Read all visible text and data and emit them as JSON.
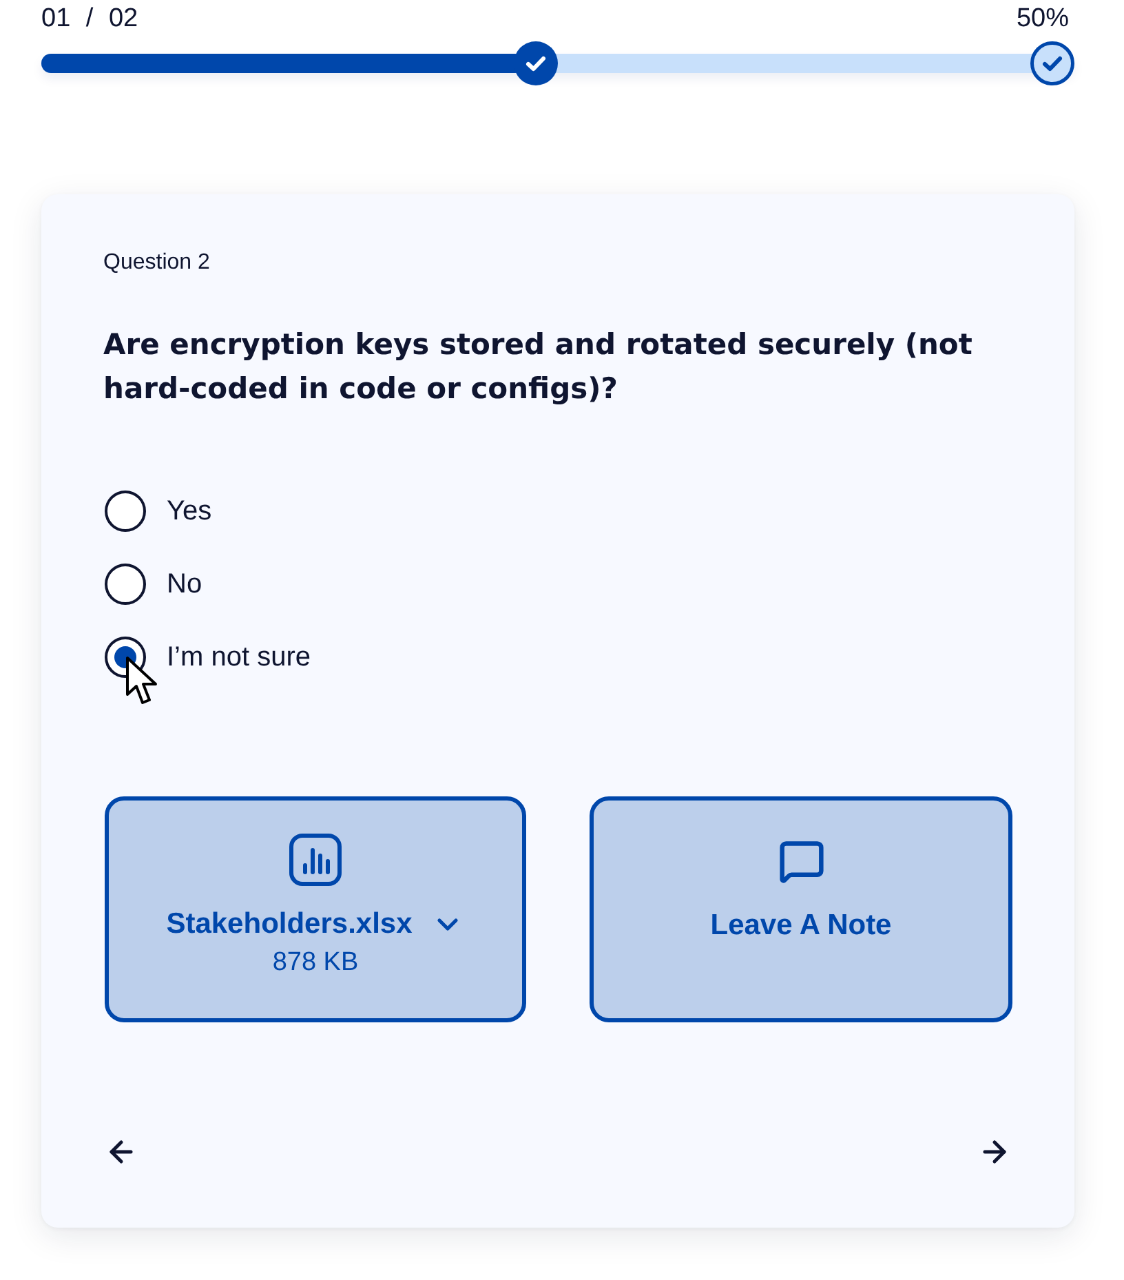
{
  "progress": {
    "step_label": "01 / 02",
    "percent": "50%",
    "level": 0.5,
    "steps": [
      {
        "completed": true
      },
      {
        "completed": false
      }
    ]
  },
  "question": {
    "number": "Question 2",
    "text": "Are encryption keys stored and rotated securely (not hard-coded in code or configs)?",
    "options": [
      {
        "label": "Yes",
        "selected": false
      },
      {
        "label": "No",
        "selected": false
      },
      {
        "label": "I’m not sure",
        "selected": true
      }
    ]
  },
  "actions": [
    {
      "kind": "file",
      "title": "Stakeholders.xlsx",
      "size": "878 KB"
    },
    {
      "kind": "note",
      "title": "Leave A Note"
    }
  ]
}
